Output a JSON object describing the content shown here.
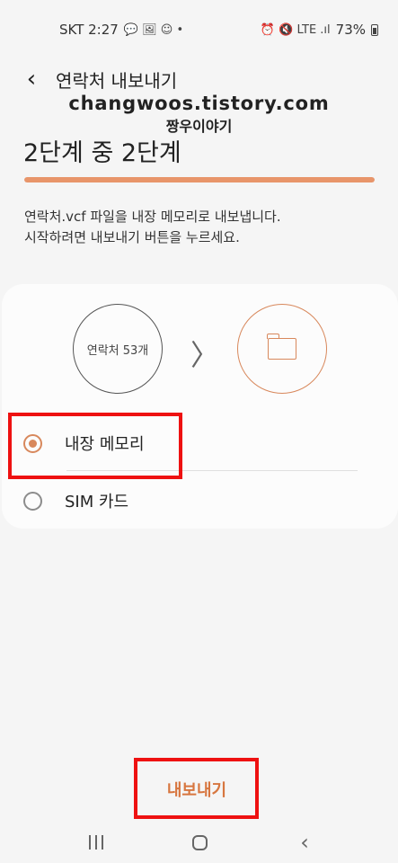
{
  "status_bar": {
    "carrier_time": "SKT 2:27",
    "notif_icons": "💬 🖼 ☺ •",
    "right_icons": "⏰ 🔇 LTE .ıl",
    "battery": "73%"
  },
  "header": {
    "back_icon": "‹",
    "title": "연락처 내보내기"
  },
  "watermark": {
    "line1": "changwoos.tistory.com",
    "line2": "짱우이야기"
  },
  "step": {
    "title": "2단계 중 2단계",
    "progress_fraction": 1.0
  },
  "description": {
    "line1": "연락처.vcf 파일을 내장 메모리로 내보냅니다.",
    "line2": "시작하려면 내보내기 버튼을 누르세요."
  },
  "card": {
    "source_label": "연락처 53개",
    "arrow": "〉",
    "options": [
      {
        "label": "내장 메모리",
        "selected": true
      },
      {
        "label": "SIM 카드",
        "selected": false
      }
    ]
  },
  "footer": {
    "export_label": "내보내기"
  },
  "nav": {
    "back_glyph": "‹"
  },
  "colors": {
    "accent": "#d8885c",
    "highlight": "#ee1111"
  }
}
